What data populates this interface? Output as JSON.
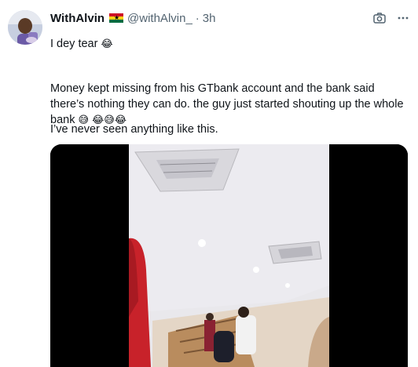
{
  "tweet": {
    "display_name": "WithAlvin",
    "handle": "@withAlvin_",
    "separator": "·",
    "time": "3h",
    "flag_icon": "ghana-flag-icon",
    "camera_icon": "camera-icon",
    "more_icon": "more-options-icon",
    "text_line1": "I dey tear",
    "text_line2": "Money kept missing from his GTbank account and the bank said there’s nothing they can do. the guy just started shouting up the whole bank",
    "text_line3": "I’ve never seen anything like this.",
    "emoji_joy": "😂",
    "emoji_sweat": "😅",
    "colors": {
      "text": "#0f1419",
      "muted": "#536471",
      "flag_red": "#ce1126",
      "flag_gold": "#fcd116",
      "flag_green": "#006b3f"
    }
  },
  "media": {
    "type": "video",
    "icon": "video-thumbnail"
  }
}
